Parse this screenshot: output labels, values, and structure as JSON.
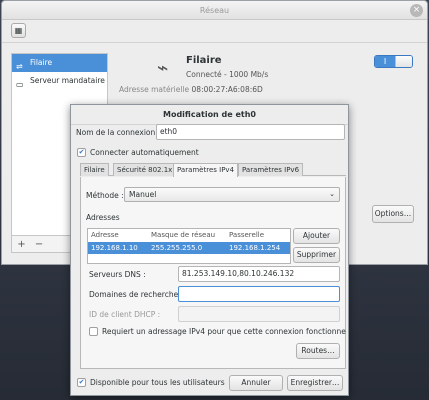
{
  "window": {
    "title": "Réseau",
    "close_glyph": "×",
    "grid_glyph": "▦"
  },
  "sidebar": {
    "items": [
      {
        "label": "Filaire",
        "icon": "wired-network-icon",
        "glyph": "⇌",
        "selected": true
      },
      {
        "label": "Serveur mandataire",
        "icon": "proxy-server-icon",
        "glyph": "▭",
        "selected": false
      }
    ],
    "add_glyph": "+",
    "remove_glyph": "−"
  },
  "device": {
    "icon_glyph": "⌁",
    "name": "Filaire",
    "status": "Connecté - 1000 Mb/s",
    "hw_label": "Adresse matérielle",
    "hw_value": "08:00:27:A6:08:6D",
    "toggle_on": "I",
    "options_label": "Options…"
  },
  "dialog": {
    "title": "Modification de eth0",
    "conn_name_label": "Nom de la connexion :",
    "conn_name_value": "eth0",
    "auto_connect_label": "Connecter automatiquement",
    "auto_connect_checked": true,
    "tabs": [
      {
        "label": "Filaire",
        "active": false
      },
      {
        "label": "Sécurité 802.1x",
        "active": false
      },
      {
        "label": "Paramètres IPv4",
        "active": true
      },
      {
        "label": "Paramètres IPv6",
        "active": false
      }
    ],
    "method_label": "Méthode :",
    "method_value": "Manuel",
    "method_arrow": "⌄",
    "addresses_heading": "Adresses",
    "columns": [
      "Adresse",
      "Masque de réseau",
      "Passerelle"
    ],
    "rows": [
      {
        "address": "192.168.1.10",
        "netmask": "255.255.255.0",
        "gateway": "192.168.1.254",
        "selected": true
      }
    ],
    "add_label": "Ajouter",
    "delete_label": "Supprimer",
    "dns_label": "Serveurs DNS :",
    "dns_value": "81.253.149.10,80.10.246.132",
    "search_label": "Domaines de recherche :",
    "search_value": "",
    "dhcp_label": "ID de client DHCP :",
    "dhcp_value": "",
    "require_ipv4_label": "Requiert un adressage IPv4 pour que cette connexion fonctionne",
    "require_ipv4_checked": false,
    "routes_label": "Routes…",
    "all_users_label": "Disponible pour tous les utilisateurs",
    "all_users_checked": true,
    "cancel_label": "Annuler",
    "save_label": "Enregistrer…",
    "check_glyph": "✔"
  },
  "colors": {
    "accent": "#4a90d9",
    "window_bg": "#ededed",
    "desktop_bg": "#2f3541"
  }
}
